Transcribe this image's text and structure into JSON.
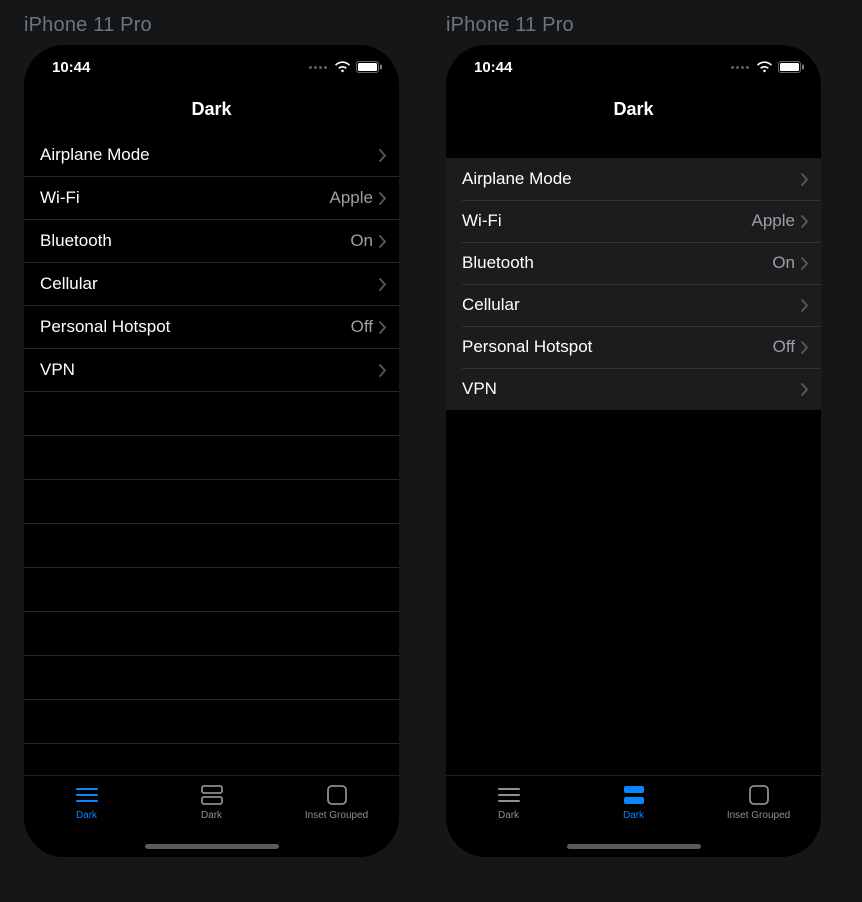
{
  "devices": [
    {
      "label": "iPhone 11 Pro",
      "clock": "10:44",
      "title": "Dark",
      "list_style": "plain",
      "rows": [
        {
          "label": "Airplane Mode",
          "value": ""
        },
        {
          "label": "Wi-Fi",
          "value": "Apple"
        },
        {
          "label": "Bluetooth",
          "value": "On"
        },
        {
          "label": "Cellular",
          "value": ""
        },
        {
          "label": "Personal Hotspot",
          "value": "Off"
        },
        {
          "label": "VPN",
          "value": ""
        }
      ],
      "tabs": [
        {
          "label": "Dark",
          "icon": "plain",
          "active": true
        },
        {
          "label": "Dark",
          "icon": "grouped",
          "active": false
        },
        {
          "label": "Inset Grouped",
          "icon": "inset",
          "active": false
        }
      ]
    },
    {
      "label": "iPhone 11 Pro",
      "clock": "10:44",
      "title": "Dark",
      "list_style": "grouped",
      "rows": [
        {
          "label": "Airplane Mode",
          "value": ""
        },
        {
          "label": "Wi-Fi",
          "value": "Apple"
        },
        {
          "label": "Bluetooth",
          "value": "On"
        },
        {
          "label": "Cellular",
          "value": ""
        },
        {
          "label": "Personal Hotspot",
          "value": "Off"
        },
        {
          "label": "VPN",
          "value": ""
        }
      ],
      "tabs": [
        {
          "label": "Dark",
          "icon": "plain",
          "active": false
        },
        {
          "label": "Dark",
          "icon": "grouped",
          "active": true
        },
        {
          "label": "Inset Grouped",
          "icon": "inset",
          "active": false
        }
      ]
    }
  ]
}
